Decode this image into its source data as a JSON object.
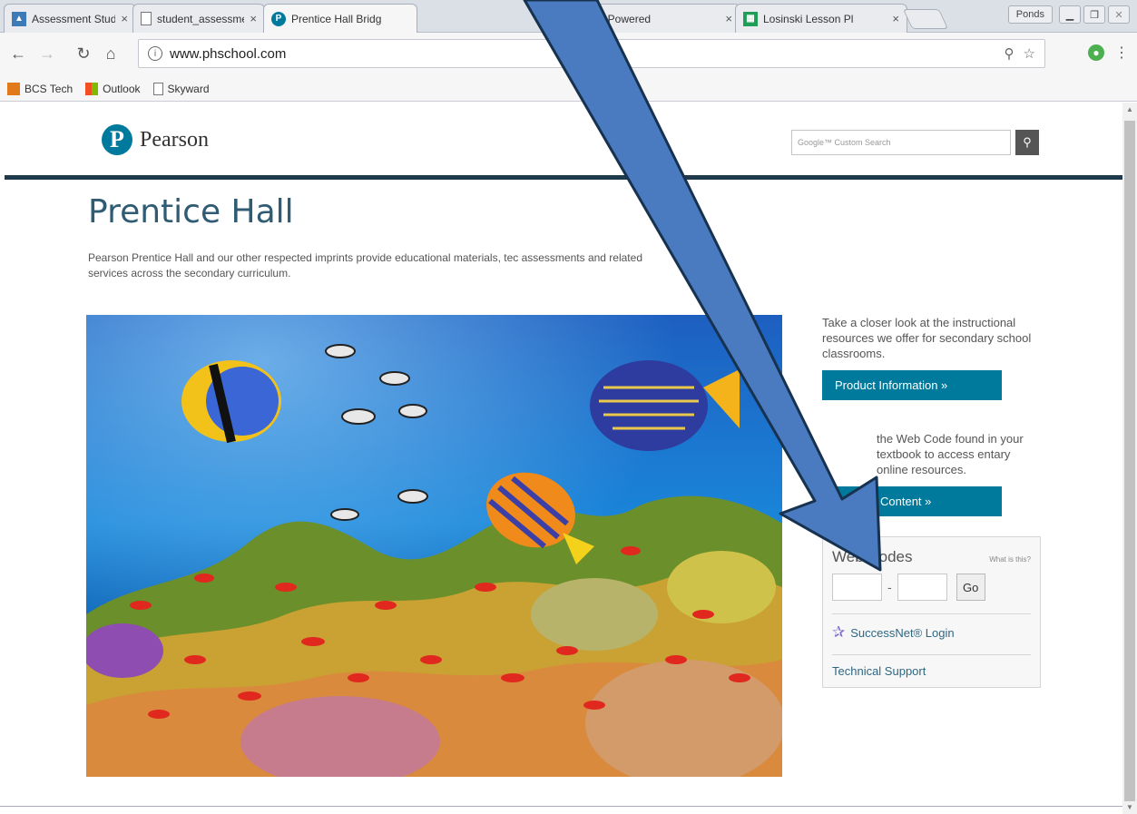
{
  "browser": {
    "tabs": [
      {
        "label": "Assessment Stude",
        "icon": "assessment-tab-icon"
      },
      {
        "label": "student_assessme",
        "icon": "document-tab-icon"
      },
      {
        "label": "Prentice Hall Bridg",
        "icon": "pearson-tab-icon",
        "active": true
      },
      {
        "label": "gin - Powered",
        "icon": "login-tab-icon"
      },
      {
        "label": "Losinski Lesson Pl",
        "icon": "sheets-tab-icon"
      }
    ],
    "user_label": "Ponds",
    "address": "www.phschool.com",
    "bookmarks": [
      {
        "label": "BCS Tech",
        "icon": "bcs-tech-icon"
      },
      {
        "label": "Outlook",
        "icon": "outlook-icon"
      },
      {
        "label": "Skyward",
        "icon": "page-icon"
      }
    ]
  },
  "site": {
    "logo_text": "Pearson",
    "search_placeholder": "Google™ Custom Search",
    "title": "Prentice Hall",
    "description": "Pearson Prentice Hall and our other respected imprints provide educational materials, tec assessments and related services across the secondary curriculum.",
    "side": {
      "promo_text": "Take a closer look at the instructional resources we offer for secondary school classrooms.",
      "product_button": "Product Information »",
      "webcode_text": "the Web Code found in your textbook to access entary online resources.",
      "content_button": "Content »",
      "webcodes_title": "Web Codes",
      "webcodes_what": "What is this?",
      "go_label": "Go",
      "successnet_label": "SuccessNet® Login",
      "support_label": "Technical Support"
    }
  },
  "colors": {
    "brand_teal": "#007a9c",
    "arrow_blue": "#4a7bc0",
    "rule_navy": "#1e3a4c"
  }
}
